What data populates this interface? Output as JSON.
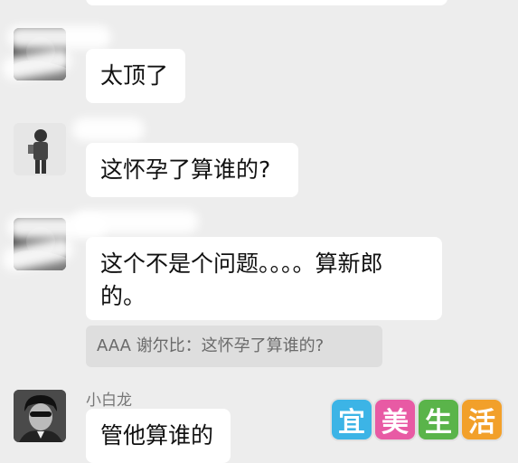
{
  "messages": [
    {
      "id": "m1",
      "text": "太顶了"
    },
    {
      "id": "m2",
      "text": "这怀孕了算谁的?"
    },
    {
      "id": "m3",
      "text": "这个不是个问题。。。。算新郎\n的。"
    },
    {
      "id": "m4",
      "text": "管他算谁的",
      "sender": "小白龙",
      "quote": "AAA 谢尔比：这怀孕了算谁的?"
    }
  ],
  "watermark": {
    "chars": [
      "宜",
      "美",
      "生",
      "活"
    ],
    "colors": [
      "#3cb4e6",
      "#e85aa4",
      "#5ab44a",
      "#f2a02a"
    ]
  },
  "theme": {
    "background": "#ededed",
    "bubble": "#ffffff",
    "quote_bg": "#dedede"
  }
}
